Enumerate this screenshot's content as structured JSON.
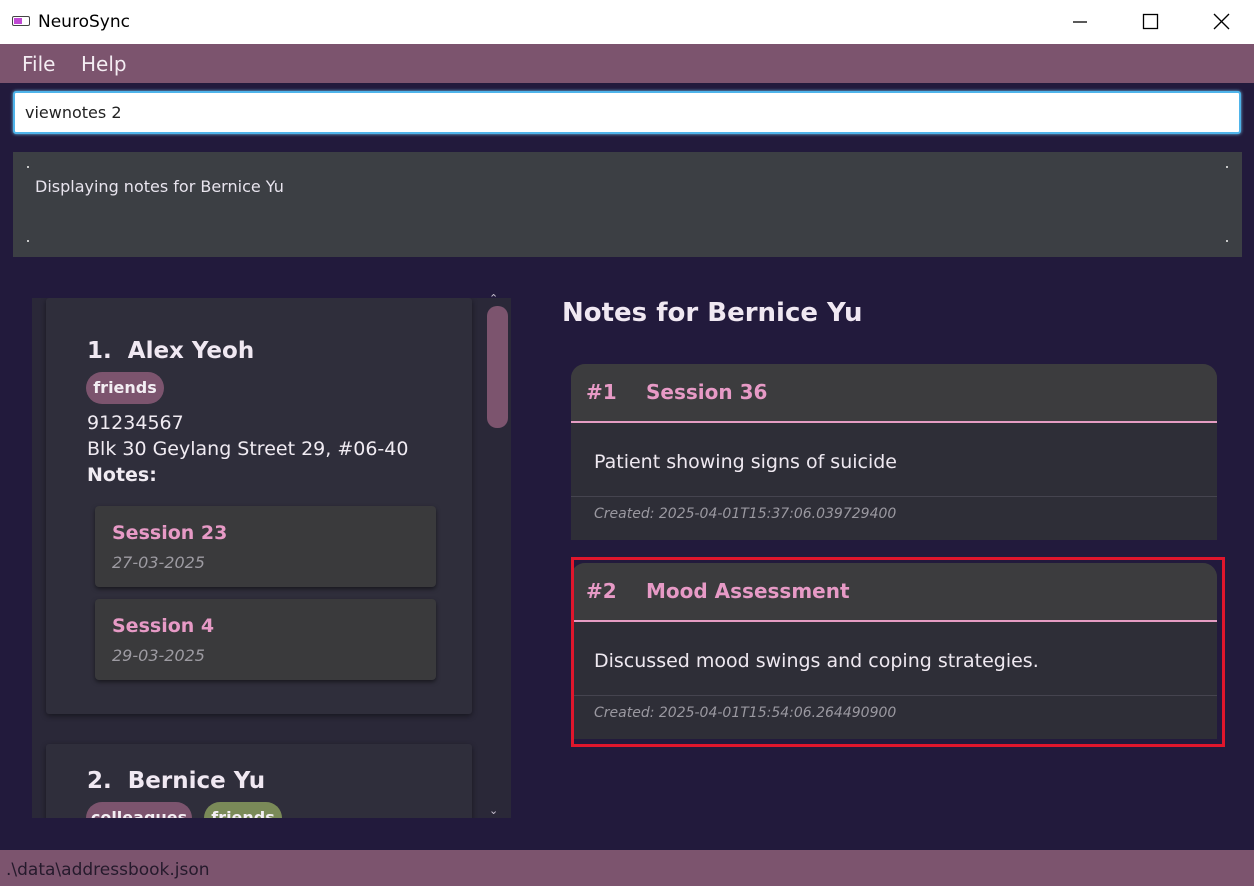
{
  "window": {
    "title": "NeuroSync"
  },
  "menu": {
    "items": [
      {
        "label": "File"
      },
      {
        "label": "Help"
      }
    ]
  },
  "command": {
    "value": "viewnotes 2"
  },
  "result": {
    "text": "Displaying notes for Bernice Yu"
  },
  "persons": [
    {
      "index": "1.",
      "name": "Alex Yeoh",
      "tags": [
        "friends"
      ],
      "phone": "91234567",
      "address": "Blk 30 Geylang Street 29, #06-40",
      "notes_label": "Notes:",
      "notes": [
        {
          "title": "Session 23",
          "date": "27-03-2025"
        },
        {
          "title": "Session 4",
          "date": "29-03-2025"
        }
      ]
    },
    {
      "index": "2.",
      "name": "Bernice Yu",
      "tags": [
        "colleagues",
        "friends"
      ]
    }
  ],
  "notes_panel": {
    "heading": "Notes for Bernice Yu",
    "notes": [
      {
        "num": "#1",
        "title": "Session 36",
        "body": "Patient showing signs of suicide",
        "created": "Created: 2025-04-01T15:37:06.039729400"
      },
      {
        "num": "#2",
        "title": "Mood Assessment",
        "body": "Discussed mood swings and coping strategies.",
        "created": "Created: 2025-04-01T15:54:06.264490900"
      }
    ]
  },
  "status": {
    "path": ".\\data\\addressbook.json"
  },
  "colors": {
    "accent": "#7c546e",
    "note_title": "#e79ac6",
    "highlight": "#e0162c",
    "tag_friends": "#7c546e",
    "tag_green": "#7a8a58"
  }
}
